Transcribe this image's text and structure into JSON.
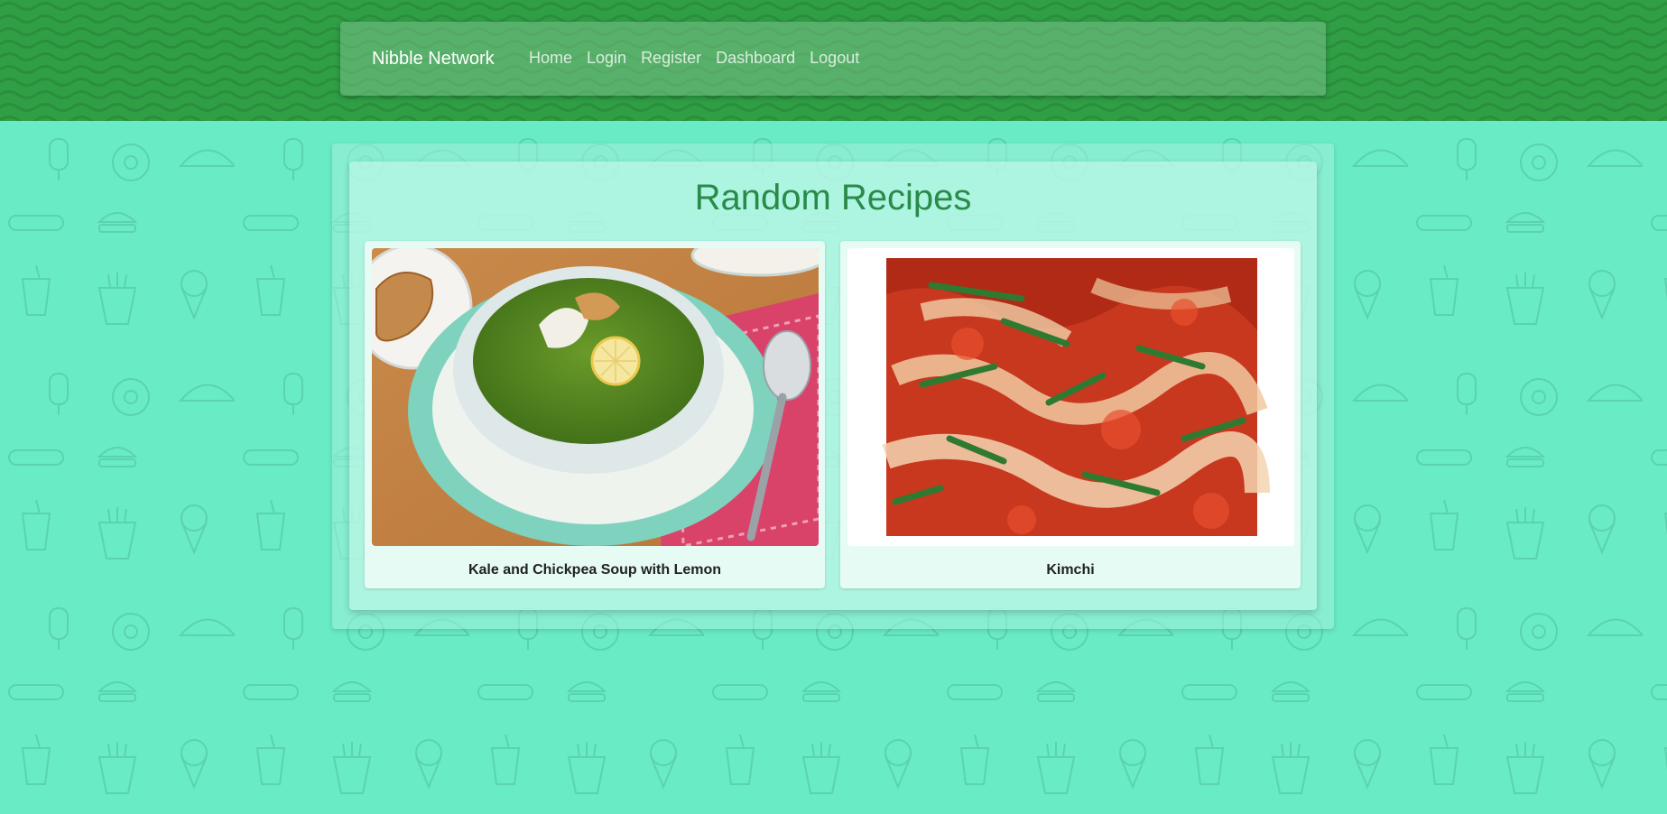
{
  "navbar": {
    "brand": "Nibble Network",
    "links": [
      "Home",
      "Login",
      "Register",
      "Dashboard",
      "Logout"
    ]
  },
  "main": {
    "title": "Random Recipes",
    "recipes": [
      {
        "name": "Kale and Chickpea Soup with Lemon",
        "image": "kale-soup-photo"
      },
      {
        "name": "Kimchi",
        "image": "kimchi-photo"
      }
    ]
  },
  "colors": {
    "header_green": "#2f9e45",
    "page_mint": "#69ebc6",
    "title_green": "#2a8a4a"
  }
}
